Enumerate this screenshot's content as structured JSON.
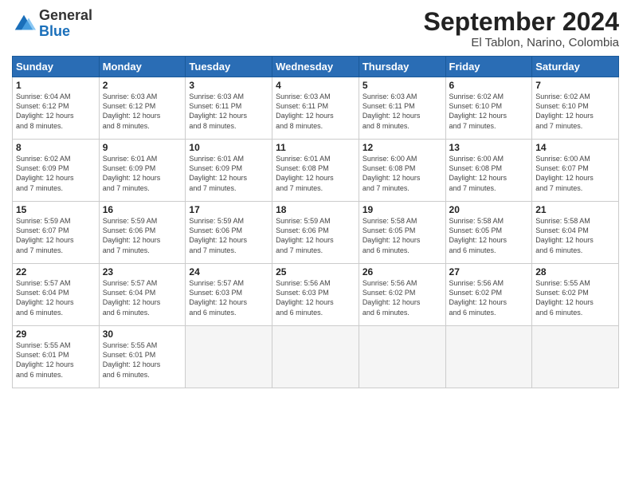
{
  "logo": {
    "general": "General",
    "blue": "Blue"
  },
  "header": {
    "month": "September 2024",
    "location": "El Tablon, Narino, Colombia"
  },
  "days_of_week": [
    "Sunday",
    "Monday",
    "Tuesday",
    "Wednesday",
    "Thursday",
    "Friday",
    "Saturday"
  ],
  "weeks": [
    [
      {
        "day": 1,
        "info": "Sunrise: 6:04 AM\nSunset: 6:12 PM\nDaylight: 12 hours\nand 8 minutes."
      },
      {
        "day": 2,
        "info": "Sunrise: 6:03 AM\nSunset: 6:12 PM\nDaylight: 12 hours\nand 8 minutes."
      },
      {
        "day": 3,
        "info": "Sunrise: 6:03 AM\nSunset: 6:11 PM\nDaylight: 12 hours\nand 8 minutes."
      },
      {
        "day": 4,
        "info": "Sunrise: 6:03 AM\nSunset: 6:11 PM\nDaylight: 12 hours\nand 8 minutes."
      },
      {
        "day": 5,
        "info": "Sunrise: 6:03 AM\nSunset: 6:11 PM\nDaylight: 12 hours\nand 8 minutes."
      },
      {
        "day": 6,
        "info": "Sunrise: 6:02 AM\nSunset: 6:10 PM\nDaylight: 12 hours\nand 7 minutes."
      },
      {
        "day": 7,
        "info": "Sunrise: 6:02 AM\nSunset: 6:10 PM\nDaylight: 12 hours\nand 7 minutes."
      }
    ],
    [
      {
        "day": 8,
        "info": "Sunrise: 6:02 AM\nSunset: 6:09 PM\nDaylight: 12 hours\nand 7 minutes."
      },
      {
        "day": 9,
        "info": "Sunrise: 6:01 AM\nSunset: 6:09 PM\nDaylight: 12 hours\nand 7 minutes."
      },
      {
        "day": 10,
        "info": "Sunrise: 6:01 AM\nSunset: 6:09 PM\nDaylight: 12 hours\nand 7 minutes."
      },
      {
        "day": 11,
        "info": "Sunrise: 6:01 AM\nSunset: 6:08 PM\nDaylight: 12 hours\nand 7 minutes."
      },
      {
        "day": 12,
        "info": "Sunrise: 6:00 AM\nSunset: 6:08 PM\nDaylight: 12 hours\nand 7 minutes."
      },
      {
        "day": 13,
        "info": "Sunrise: 6:00 AM\nSunset: 6:08 PM\nDaylight: 12 hours\nand 7 minutes."
      },
      {
        "day": 14,
        "info": "Sunrise: 6:00 AM\nSunset: 6:07 PM\nDaylight: 12 hours\nand 7 minutes."
      }
    ],
    [
      {
        "day": 15,
        "info": "Sunrise: 5:59 AM\nSunset: 6:07 PM\nDaylight: 12 hours\nand 7 minutes."
      },
      {
        "day": 16,
        "info": "Sunrise: 5:59 AM\nSunset: 6:06 PM\nDaylight: 12 hours\nand 7 minutes."
      },
      {
        "day": 17,
        "info": "Sunrise: 5:59 AM\nSunset: 6:06 PM\nDaylight: 12 hours\nand 7 minutes."
      },
      {
        "day": 18,
        "info": "Sunrise: 5:59 AM\nSunset: 6:06 PM\nDaylight: 12 hours\nand 7 minutes."
      },
      {
        "day": 19,
        "info": "Sunrise: 5:58 AM\nSunset: 6:05 PM\nDaylight: 12 hours\nand 6 minutes."
      },
      {
        "day": 20,
        "info": "Sunrise: 5:58 AM\nSunset: 6:05 PM\nDaylight: 12 hours\nand 6 minutes."
      },
      {
        "day": 21,
        "info": "Sunrise: 5:58 AM\nSunset: 6:04 PM\nDaylight: 12 hours\nand 6 minutes."
      }
    ],
    [
      {
        "day": 22,
        "info": "Sunrise: 5:57 AM\nSunset: 6:04 PM\nDaylight: 12 hours\nand 6 minutes."
      },
      {
        "day": 23,
        "info": "Sunrise: 5:57 AM\nSunset: 6:04 PM\nDaylight: 12 hours\nand 6 minutes."
      },
      {
        "day": 24,
        "info": "Sunrise: 5:57 AM\nSunset: 6:03 PM\nDaylight: 12 hours\nand 6 minutes."
      },
      {
        "day": 25,
        "info": "Sunrise: 5:56 AM\nSunset: 6:03 PM\nDaylight: 12 hours\nand 6 minutes."
      },
      {
        "day": 26,
        "info": "Sunrise: 5:56 AM\nSunset: 6:02 PM\nDaylight: 12 hours\nand 6 minutes."
      },
      {
        "day": 27,
        "info": "Sunrise: 5:56 AM\nSunset: 6:02 PM\nDaylight: 12 hours\nand 6 minutes."
      },
      {
        "day": 28,
        "info": "Sunrise: 5:55 AM\nSunset: 6:02 PM\nDaylight: 12 hours\nand 6 minutes."
      }
    ],
    [
      {
        "day": 29,
        "info": "Sunrise: 5:55 AM\nSunset: 6:01 PM\nDaylight: 12 hours\nand 6 minutes."
      },
      {
        "day": 30,
        "info": "Sunrise: 5:55 AM\nSunset: 6:01 PM\nDaylight: 12 hours\nand 6 minutes."
      },
      {
        "day": null,
        "info": ""
      },
      {
        "day": null,
        "info": ""
      },
      {
        "day": null,
        "info": ""
      },
      {
        "day": null,
        "info": ""
      },
      {
        "day": null,
        "info": ""
      }
    ]
  ]
}
